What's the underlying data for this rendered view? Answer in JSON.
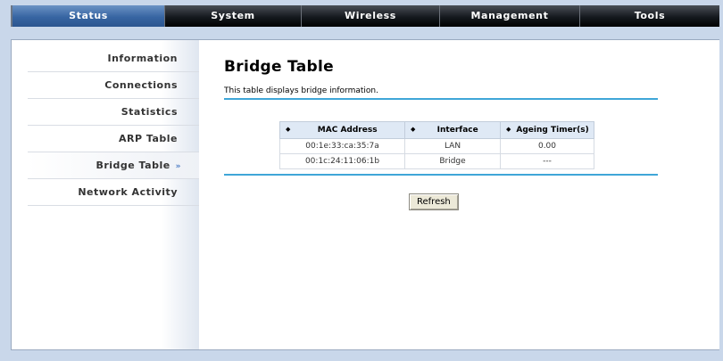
{
  "topnav": {
    "tabs": [
      {
        "label": "Status",
        "active": true
      },
      {
        "label": "System",
        "active": false
      },
      {
        "label": "Wireless",
        "active": false
      },
      {
        "label": "Management",
        "active": false
      },
      {
        "label": "Tools",
        "active": false
      }
    ]
  },
  "sidebar": {
    "items": [
      {
        "label": "Information"
      },
      {
        "label": "Connections"
      },
      {
        "label": "Statistics"
      },
      {
        "label": "ARP Table"
      },
      {
        "label": "Bridge Table",
        "active": true,
        "arrow": "»"
      },
      {
        "label": "Network Activity"
      }
    ]
  },
  "main": {
    "title": "Bridge Table",
    "description": "This table displays bridge information.",
    "table": {
      "sort_glyph": "◆",
      "headers": [
        "MAC Address",
        "Interface",
        "Ageing Timer(s)"
      ],
      "rows": [
        [
          "00:1e:33:ca:35:7a",
          "LAN",
          "0.00"
        ],
        [
          "00:1c:24:11:06:1b",
          "Bridge",
          "---"
        ]
      ]
    },
    "refresh_label": "Refresh"
  },
  "colors": {
    "accent_blue": "#3fa6d8",
    "active_tab": "#3765a2",
    "nav_dark": "#15191e",
    "background": "#c9d7ea"
  }
}
